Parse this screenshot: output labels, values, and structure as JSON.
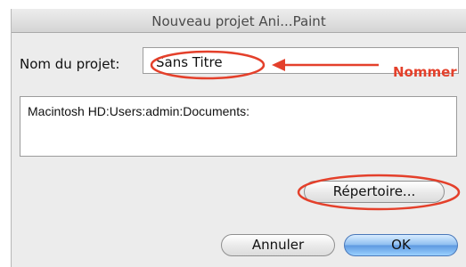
{
  "dialog": {
    "title": "Nouveau projet Ani...Paint",
    "name_label": "Nom du projet:",
    "name_value": "Sans Titre",
    "path_value": "Macintosh HD:Users:admin:Documents:"
  },
  "buttons": {
    "directory": "Répertoire...",
    "cancel": "Annuler",
    "ok": "OK"
  },
  "annotation": {
    "label": "Nommer",
    "color": "#e4402b"
  },
  "colors": {
    "window_bg": "#ececec",
    "default_button": "#5d98e0",
    "annotation": "#e4402b"
  }
}
